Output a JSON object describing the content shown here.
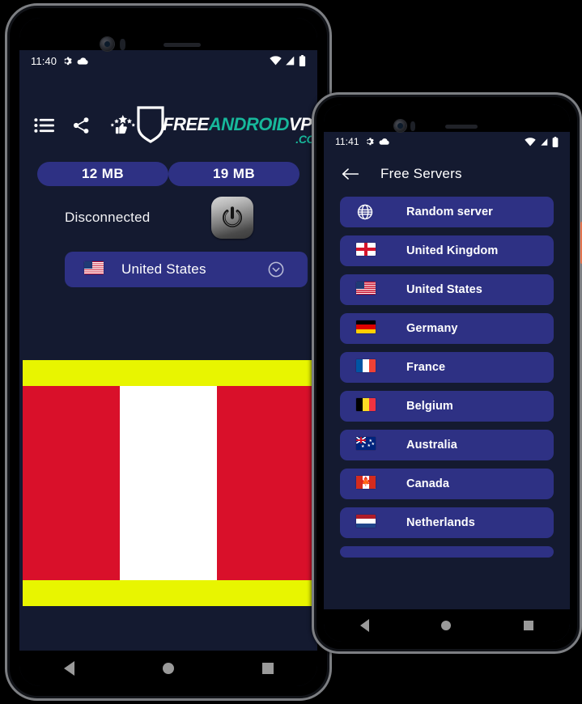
{
  "phone1": {
    "status_bar": {
      "time": "11:40",
      "icons_left": [
        "gear-icon",
        "cloud-icon"
      ],
      "icons_right": [
        "wifi-icon",
        "signal-icon",
        "battery-icon"
      ]
    },
    "toolbar": {
      "icons": [
        {
          "name": "list-icon",
          "label": "Server list"
        },
        {
          "name": "share-icon",
          "label": "Share"
        },
        {
          "name": "rate-icon",
          "label": "Rate us"
        }
      ]
    },
    "logo": {
      "free": "FREE",
      "android": "ANDROID",
      "vpn": "VPN",
      "dotcom": ".COM",
      "shield": "shield-icon"
    },
    "usage": {
      "download": "12 MB",
      "upload": "19 MB"
    },
    "connection": {
      "status": "Disconnected",
      "power_button": "power-icon"
    },
    "country": {
      "flag": "🇺🇸",
      "name": "United States",
      "chevron": "chevron-down-icon"
    },
    "ad_banner": {
      "top_bar_color": "#e8f500",
      "bottom_bar_color": "#e8f500",
      "flag_colors": [
        "#d9102a",
        "#ffffff",
        "#d9102a"
      ]
    },
    "nav": [
      "back-button",
      "home-button",
      "recents-button"
    ]
  },
  "phone2": {
    "status_bar": {
      "time": "11:41",
      "icons_left": [
        "gear-icon",
        "cloud-icon"
      ],
      "icons_right": [
        "wifi-icon",
        "signal-icon",
        "battery-icon"
      ]
    },
    "header": {
      "back": "back-arrow-icon",
      "title": "Free Servers"
    },
    "servers": [
      {
        "label": "Random server",
        "icon": "globe-icon"
      },
      {
        "label": "United Kingdom",
        "icon": "flag-uk"
      },
      {
        "label": "United States",
        "icon": "flag-us"
      },
      {
        "label": "Germany",
        "icon": "flag-de"
      },
      {
        "label": "France",
        "icon": "flag-fr"
      },
      {
        "label": "Belgium",
        "icon": "flag-be"
      },
      {
        "label": "Australia",
        "icon": "flag-au"
      },
      {
        "label": "Canada",
        "icon": "flag-ca"
      },
      {
        "label": "Netherlands",
        "icon": "flag-nl"
      }
    ],
    "nav": [
      "back-button",
      "home-button",
      "recents-button"
    ]
  },
  "colors": {
    "screen_bg": "#141a30",
    "accent": "#2e3184",
    "brand_teal": "#17b89b",
    "banner_yellow": "#e8f500",
    "banner_red": "#d9102a",
    "power_key": "#e2744f"
  }
}
